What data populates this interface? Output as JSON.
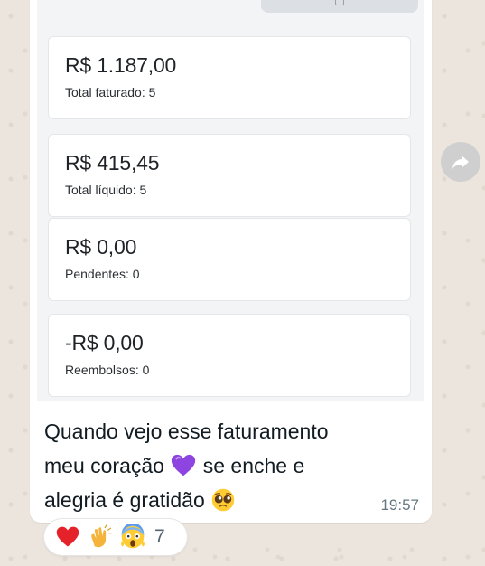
{
  "message": {
    "cards": [
      {
        "amount": "R$ 1.187,00",
        "label": "Total faturado: 5"
      },
      {
        "amount": "R$ 415,45",
        "label": "Total líquido: 5"
      },
      {
        "amount": "R$ 0,00",
        "label": "Pendentes: 0"
      },
      {
        "amount": "-R$ 0,00",
        "label": "Reembolsos: 0"
      }
    ],
    "text_line1": "Quando vejo esse faturamento",
    "text_line2a": "meu coração",
    "text_line2b": "se enche e",
    "text_line3": "alegria é gratidão",
    "time": "19:57"
  },
  "reactions": {
    "emojis": [
      "red-heart",
      "clapping-hands",
      "screaming-face"
    ],
    "count": "7"
  },
  "colors": {
    "wallpaper": "#ece5dd",
    "bubble": "#ffffff",
    "heart_purple": "#8e44e0"
  }
}
